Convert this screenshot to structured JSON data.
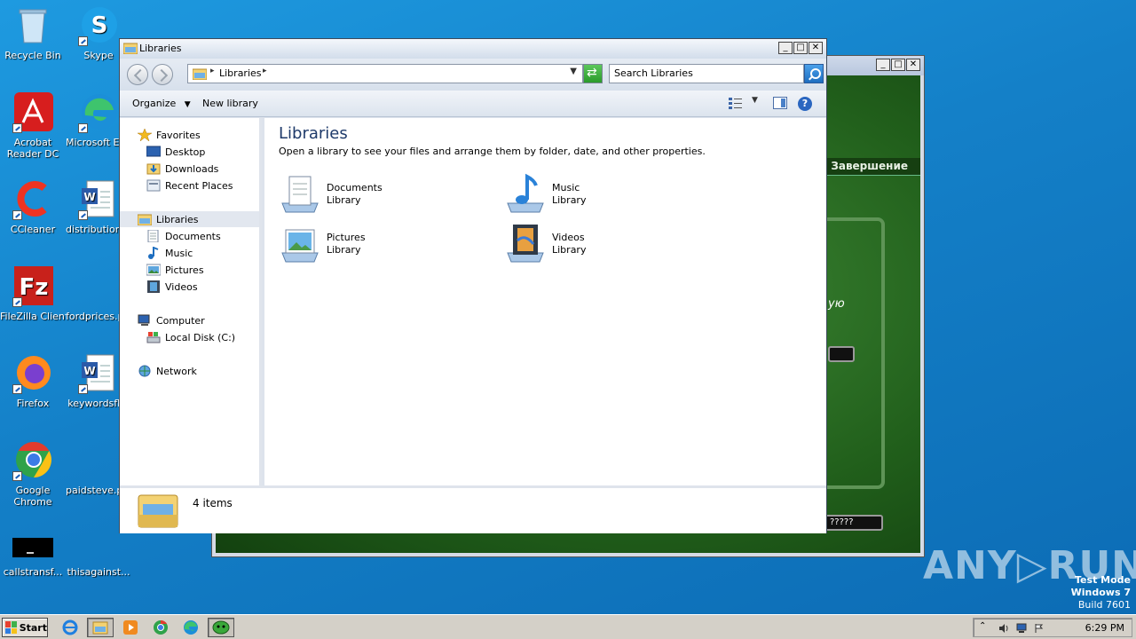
{
  "desktop": {
    "icons": [
      {
        "label": "Recycle Bin"
      },
      {
        "label": "Skype"
      },
      {
        "label": "Acrobat Reader DC"
      },
      {
        "label": "Microsoft Edge"
      },
      {
        "label": "CCleaner"
      },
      {
        "label": "distributions..."
      },
      {
        "label": "FileZilla Client"
      },
      {
        "label": "fordprices.p..."
      },
      {
        "label": "Firefox"
      },
      {
        "label": "keywordsfl..."
      },
      {
        "label": "Google Chrome"
      },
      {
        "label": "paidsteve.p..."
      },
      {
        "label": "callstransf..."
      },
      {
        "label": "thisagainst..."
      }
    ]
  },
  "background_window": {
    "menu_label": "Завершение",
    "side_text": "ую",
    "field_text": "?????"
  },
  "explorer": {
    "title": "Libraries",
    "address": {
      "location": "Libraries"
    },
    "search": {
      "placeholder": "Search Libraries"
    },
    "toolbar": {
      "organize": "Organize",
      "new_library": "New library"
    },
    "nav": {
      "favorites": "Favorites",
      "desktop": "Desktop",
      "downloads": "Downloads",
      "recent_places": "Recent Places",
      "libraries": "Libraries",
      "documents": "Documents",
      "music": "Music",
      "pictures": "Pictures",
      "videos": "Videos",
      "computer": "Computer",
      "local_disk": "Local Disk (C:)",
      "network": "Network"
    },
    "content": {
      "heading": "Libraries",
      "description": "Open a library to see your files and arrange them by folder, date, and other properties.",
      "libraries": [
        {
          "name": "Documents",
          "type": "Library"
        },
        {
          "name": "Music",
          "type": "Library"
        },
        {
          "name": "Pictures",
          "type": "Library"
        },
        {
          "name": "Videos",
          "type": "Library"
        }
      ]
    },
    "status": {
      "count": "4 items"
    }
  },
  "watermark": {
    "brand": "ANY▷RUN"
  },
  "os": {
    "line1": "Test Mode",
    "line2": "Windows 7",
    "line3": "Build 7601"
  },
  "taskbar": {
    "start": "Start",
    "clock": "6:29 PM"
  }
}
